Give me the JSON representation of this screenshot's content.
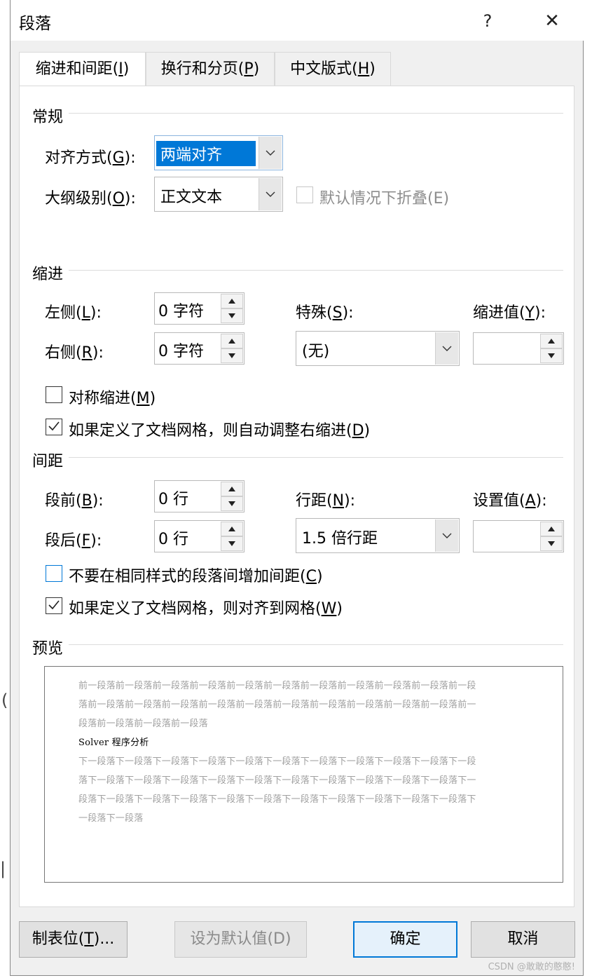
{
  "window": {
    "title": "段落",
    "help_label": "?",
    "close_label": "✕"
  },
  "tabs": [
    {
      "label_pre": "缩进和间距(",
      "key": "I",
      "label_post": ")",
      "active": true
    },
    {
      "label_pre": "换行和分页(",
      "key": "P",
      "label_post": ")",
      "active": false
    },
    {
      "label_pre": "中文版式(",
      "key": "H",
      "label_post": ")",
      "active": false
    }
  ],
  "general": {
    "section_title": "常规",
    "alignment": {
      "label_pre": "对齐方式(",
      "key": "G",
      "label_post": "):",
      "value": "两端对齐"
    },
    "outline": {
      "label_pre": "大纲级别(",
      "key": "O",
      "label_post": "):",
      "value": "正文文本"
    },
    "collapse_label": "默认情况下折叠(E)"
  },
  "indent": {
    "section_title": "缩进",
    "left": {
      "label_pre": "左侧(",
      "key": "L",
      "label_post": "):",
      "value": "0 字符"
    },
    "right": {
      "label_pre": "右侧(",
      "key": "R",
      "label_post": "):",
      "value": "0 字符"
    },
    "special": {
      "label_pre": "特殊(",
      "key": "S",
      "label_post": "):",
      "value": "(无)"
    },
    "by": {
      "label_pre": "缩进值(",
      "key": "Y",
      "label_post": "):",
      "value": ""
    },
    "mirror": {
      "label_pre": "对称缩进(",
      "key": "M",
      "label_post": ")",
      "checked": false
    },
    "auto_adjust": {
      "label_pre": "如果定义了文档网格，则自动调整右缩进(",
      "key": "D",
      "label_post": ")",
      "checked": true
    }
  },
  "spacing": {
    "section_title": "间距",
    "before": {
      "label_pre": "段前(",
      "key": "B",
      "label_post": "):",
      "value": "0 行"
    },
    "after": {
      "label_pre": "段后(",
      "key": "F",
      "label_post": "):",
      "value": "0 行"
    },
    "line_spacing": {
      "label_pre": "行距(",
      "key": "N",
      "label_post": "):",
      "value": "1.5 倍行距"
    },
    "at": {
      "label_pre": "设置值(",
      "key": "A",
      "label_post": "):",
      "value": ""
    },
    "no_space_same_style": {
      "label_pre": "不要在相同样式的段落间增加间距(",
      "key": "C",
      "label_post": ")",
      "checked": false
    },
    "snap_to_grid": {
      "label_pre": "如果定义了文档网格，则对齐到网格(",
      "key": "W",
      "label_post": ")",
      "checked": true
    }
  },
  "preview": {
    "section_title": "预览",
    "before_lines": [
      "前一段落前一段落前一段落前一段落前一段落前一段落前一段落前一段落前一段落前一段落前一段",
      "落前一段落前一段落前一段落前一段落前一段落前一段落前一段落前一段落前一段落前一段落前一",
      "段落前一段落前一段落前一段落"
    ],
    "main_text": "Solver 程序分析",
    "after_lines": [
      "下一段落下一段落下一段落下一段落下一段落下一段落下一段落下一段落下一段落下一段落下一段",
      "落下一段落下一段落下一段落下一段落下一段落下一段落下一段落下一段落下一段落下一段落下一",
      "段落下一段落下一段落下一段落下一段落下一段落下一段落下一段落下一段落下一段落下一段落下",
      "一段落下一段落"
    ]
  },
  "buttons": {
    "tabs": {
      "label_pre": "制表位(",
      "key": "T",
      "label_post": ")..."
    },
    "set_default": "设为默认值(D)",
    "ok": "确定",
    "cancel": "取消"
  },
  "watermark": "CSDN @敢敢的憨憨!",
  "colors": {
    "accent": "#0078d7",
    "selection": "#0078d7"
  }
}
